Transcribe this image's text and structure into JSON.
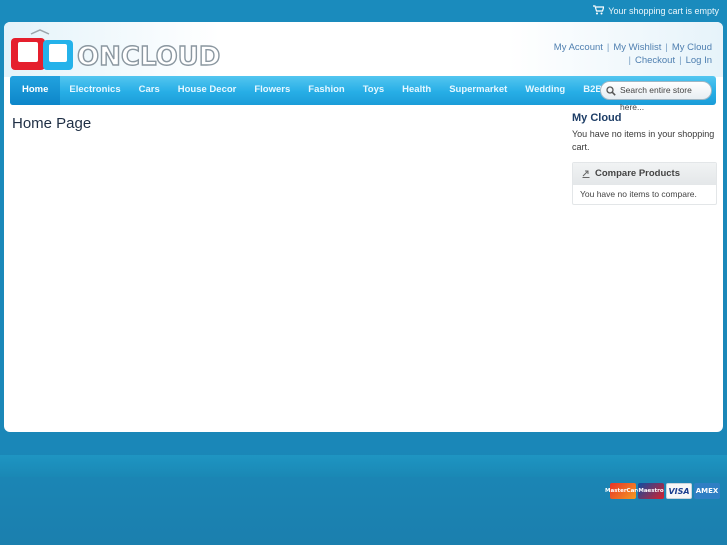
{
  "top_bar": {
    "cart_status": "Your shopping cart is empty"
  },
  "header": {
    "logo_text": "ONCLOUD",
    "links_row1": [
      "My Account",
      "My Wishlist",
      "My Cloud"
    ],
    "links_row2": [
      "Checkout",
      "Log In"
    ]
  },
  "nav": {
    "items": [
      "Home",
      "Electronics",
      "Cars",
      "House Decor",
      "Flowers",
      "Fashion",
      "Toys",
      "Health",
      "Supermarket",
      "Wedding",
      "B2B"
    ],
    "active": "Home"
  },
  "search": {
    "placeholder": "Search entire store here..."
  },
  "main": {
    "title": "Home Page"
  },
  "sidebar": {
    "my_cloud_title": "My Cloud",
    "cart_message": "You have no items in your shopping cart.",
    "compare_title": "Compare Products",
    "compare_message": "You have no items to compare."
  },
  "footer": {
    "payment_cards": [
      "MasterCard",
      "Maestro",
      "VISA",
      "AMEX"
    ]
  },
  "colors": {
    "nav_bg": "#27aee6",
    "nav_active": "#0d86c9",
    "link": "#4f7fb0",
    "page_bg": "#1a8bbd"
  }
}
